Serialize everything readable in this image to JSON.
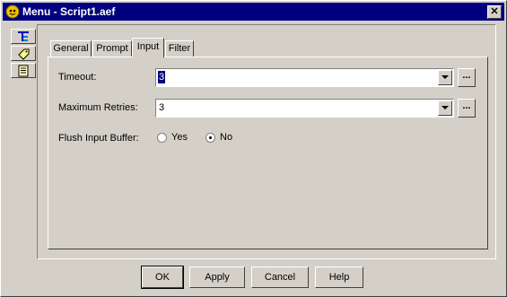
{
  "window": {
    "title": "Menu - Script1.aef",
    "close_label": "✕"
  },
  "sidebar": {
    "items": [
      {
        "icon": "tree-icon"
      },
      {
        "icon": "tag-icon"
      },
      {
        "icon": "document-icon"
      }
    ]
  },
  "tabs": [
    {
      "label": "General",
      "active": false
    },
    {
      "label": "Prompt",
      "active": false
    },
    {
      "label": "Input",
      "active": true
    },
    {
      "label": "Filter",
      "active": false
    }
  ],
  "form": {
    "timeout": {
      "label": "Timeout:",
      "value": "3"
    },
    "max_retries": {
      "label": "Maximum Retries:",
      "value": "3"
    },
    "flush": {
      "label": "Flush Input Buffer:",
      "options": [
        {
          "label": "Yes",
          "checked": false
        },
        {
          "label": "No",
          "checked": true
        }
      ]
    },
    "ellipsis_label": "..."
  },
  "buttons": {
    "ok": "OK",
    "apply": "Apply",
    "cancel": "Cancel",
    "help": "Help"
  }
}
